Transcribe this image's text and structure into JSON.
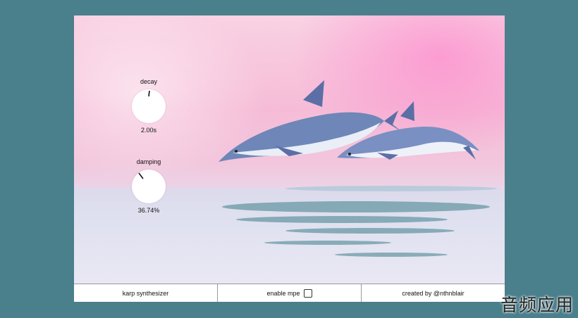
{
  "knobs": {
    "decay": {
      "label": "decay",
      "value": "2.00s"
    },
    "damping": {
      "label": "damping",
      "value": "36.74%"
    }
  },
  "bottombar": {
    "title": "karp synthesizer",
    "mpe_label": "enable mpe",
    "mpe_checked": false,
    "credit": "created by @nthnblair"
  },
  "watermark": "音频应用",
  "colors": {
    "page_background": "#4a7f8c",
    "knob_fill": "#ffffff",
    "bar_background": "#ffffff"
  }
}
